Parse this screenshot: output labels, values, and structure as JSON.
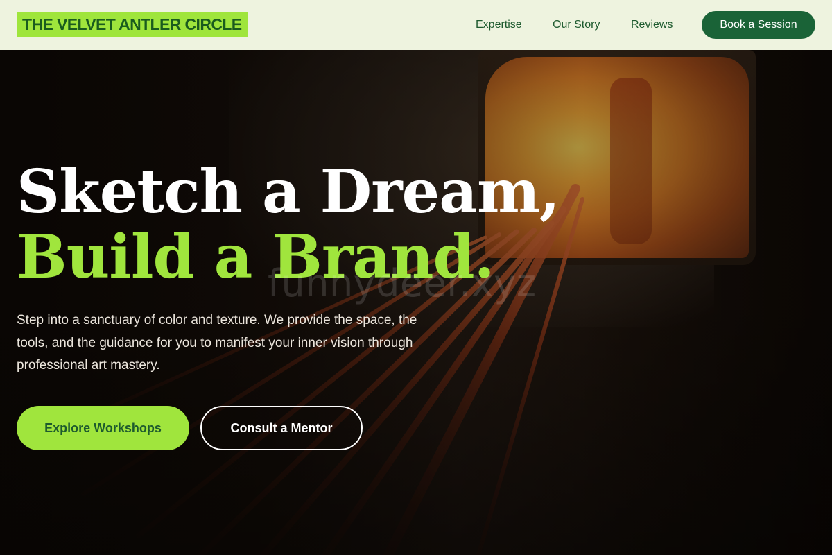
{
  "navbar": {
    "brand": "THE VELVET ANTLER CIRCLE",
    "links": [
      "Expertise",
      "Our Story",
      "Reviews"
    ],
    "cta_label": "Book a Session"
  },
  "hero": {
    "headline_line1": "Sketch a Dream,",
    "headline_line2": "Build a Brand.",
    "watermark": "funnydeer.xyz",
    "subtext": "Step into a sanctuary of color and texture. We provide the space, the tools, and the guidance for you to manifest your inner vision through professional art mastery.",
    "primary_button": "Explore Workshops",
    "secondary_button": "Consult a Mentor"
  },
  "colors": {
    "nav_bg": "#eef3df",
    "accent_green": "#a0e53d",
    "dark_green": "#1a6337",
    "text_green": "#1d5a2e"
  }
}
